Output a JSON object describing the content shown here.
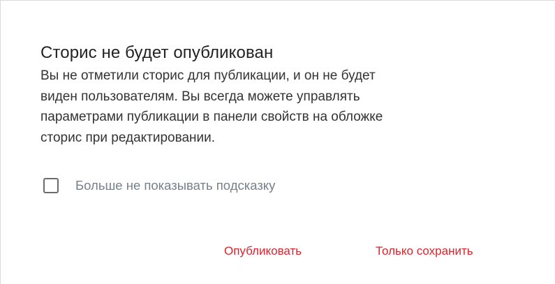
{
  "dialog": {
    "title": "Сторис не будет опубликован",
    "message_lines": [
      "Вы не отметили сторис для публикации, и он не будет",
      "виден пользователям. Вы всегда можете управлять",
      "параметрами публикации в панели свойств на обложке",
      "сторис при редактировании."
    ],
    "checkbox": {
      "label": "Больше не показывать подсказку",
      "checked": false
    },
    "actions": {
      "publish_label": "Опубликовать",
      "save_only_label": "Только сохранить"
    }
  },
  "colors": {
    "accent": "#d8262e",
    "title": "#222222",
    "text": "#333333",
    "muted": "#767f8a"
  }
}
